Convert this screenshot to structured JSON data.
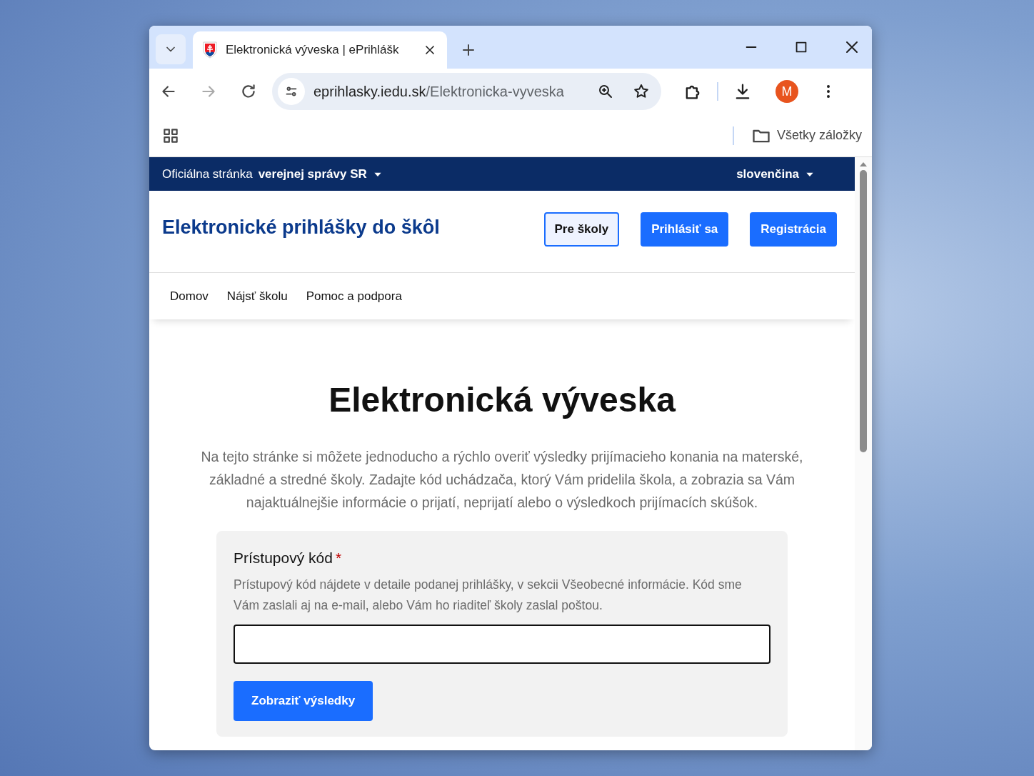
{
  "browser": {
    "tab": {
      "title": "Elektronická výveska | ePrihlášk",
      "selected": true
    },
    "address": {
      "host": "eprihlasky.iedu.sk",
      "path": "/Elektronicka-vyveska"
    },
    "avatar": "M",
    "bookmarks": {
      "label": "Všetky záložky"
    }
  },
  "topbar": {
    "official": "Oficiálna stránka",
    "official_bold": "verejnej správy SR",
    "language": "slovenčina"
  },
  "header": {
    "title": "Elektronické prihlášky do škôl",
    "buttons": [
      {
        "label": "Pre školy",
        "kind": "outline"
      },
      {
        "label": "Prihlásiť sa",
        "kind": "primary"
      },
      {
        "label": "Registrácia",
        "kind": "primary"
      }
    ]
  },
  "nav": [
    "Domov",
    "Nájsť školu",
    "Pomoc a podpora"
  ],
  "heading": "Elektronická výveska",
  "intro": "Na tejto stránke si môžete jednoducho a rýchlo overiť výsledky prijímacieho konania na materské, základné a stredné školy. Zadajte kód uchádzača, ktorý Vám pridelila škola, a zobrazia sa Vám najaktuálnejšie informácie o prijatí, neprijatí alebo o výsledkoch prijímacích skúšok.",
  "form": {
    "label": "Prístupový kód",
    "required": true,
    "required_mark": "*",
    "hint": "Prístupový kód nájdete v detaile podanej prihlášky, v sekcii Všeobecné informácie. Kód sme Vám zaslali aj na e-mail, alebo Vám ho riaditeľ školy zaslal poštou.",
    "submit": "Zobraziť výsledky"
  }
}
